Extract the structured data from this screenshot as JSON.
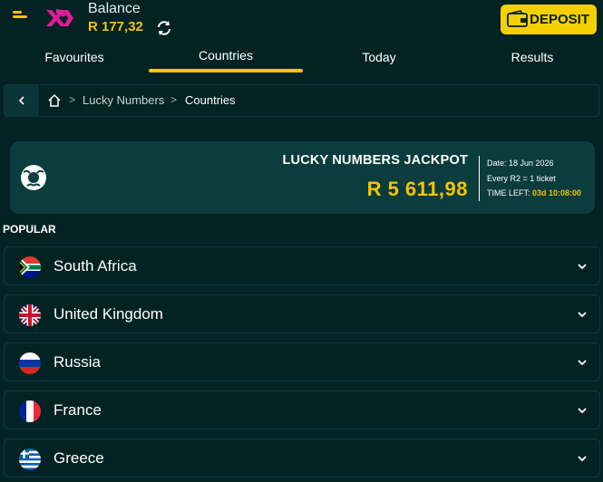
{
  "header": {
    "balance_label": "Balance",
    "balance_value": "R 177,32",
    "deposit_label": "DEPOSIT",
    "icons": {
      "menu": "menu-icon",
      "logo": "brand-logo",
      "refresh": "refresh-icon",
      "wallet": "wallet-icon"
    }
  },
  "tabs": [
    {
      "label": "Favourites",
      "active": false
    },
    {
      "label": "Countries",
      "active": true
    },
    {
      "label": "Today",
      "active": false
    },
    {
      "label": "Results",
      "active": false
    }
  ],
  "breadcrumb": {
    "back_icon": "chevron-left-icon",
    "home_icon": "home-icon",
    "separator": ">",
    "items": [
      "Lucky Numbers",
      "Countries"
    ]
  },
  "jackpot": {
    "title": "LUCKY NUMBERS JACKPOT",
    "amount": "R 5 611,98",
    "date": "Date: 18 Jun 2026",
    "rule": "Every R2 = 1 ticket",
    "time_left_label": "TIME LEFT:",
    "time_left_value": "03d 10:08:00",
    "icon": "lottery-ball-icon"
  },
  "popular": {
    "title": "POPULAR",
    "countries": [
      {
        "name": "South Africa",
        "flag": "south-africa-flag-icon"
      },
      {
        "name": "United Kingdom",
        "flag": "united-kingdom-flag-icon"
      },
      {
        "name": "Russia",
        "flag": "russia-flag-icon"
      },
      {
        "name": "France",
        "flag": "france-flag-icon"
      },
      {
        "name": "Greece",
        "flag": "greece-flag-icon"
      }
    ]
  },
  "colors": {
    "background": "#032224",
    "accent": "#f5c400",
    "card": "#0b3c3e",
    "brand_pink": "#e5199b"
  }
}
